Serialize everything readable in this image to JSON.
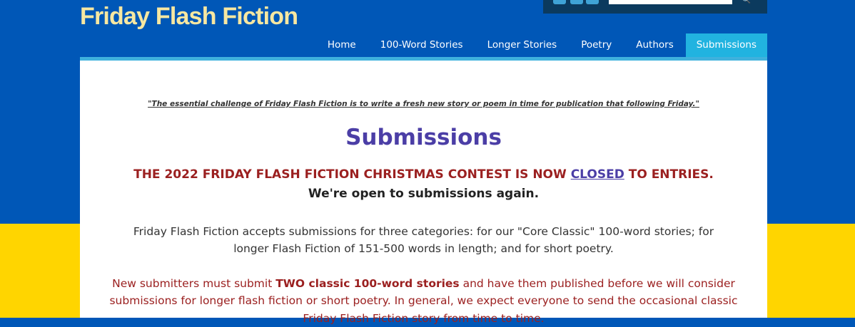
{
  "site": {
    "title": "Friday Flash Fiction"
  },
  "topbar": {
    "search_placeholder": "",
    "search_icon": "search-icon"
  },
  "nav": {
    "items": [
      {
        "label": "Home"
      },
      {
        "label": "100-Word Stories"
      },
      {
        "label": "Longer Stories"
      },
      {
        "label": "Poetry"
      },
      {
        "label": "Authors"
      },
      {
        "label": "Submissions",
        "active": true
      }
    ]
  },
  "main": {
    "quote": "\"The essential challenge of Friday Flash Fiction is to write a fresh new story or poem in time for publication that following Friday.\"",
    "heading": "Submissions",
    "announcement": {
      "part1": "THE 2022 FRIDAY FLASH FICTION CHRISTMAS CONTEST IS NOW ",
      "link": "CLOSED",
      "part2": " TO ENTRIES.",
      "part3": " We're open to submissions again."
    },
    "intro": "Friday Flash Fiction accepts submissions for three categories: for our \"Core Classic\" 100-word stories; for longer Flash Fiction of 151-500 words in length; and for short poetry.",
    "rules": {
      "part1": "New submitters must submit ",
      "bold": "TWO classic 100-word stories",
      "part2": " and have them published before we will consider submissions for longer flash fiction or short poetry. In general, we expect everyone to send the occasional classic Friday Flash Fiction story from time to time."
    }
  },
  "colors": {
    "flag_blue": "#0057b7",
    "flag_yellow": "#ffd500",
    "title": "#f7e7a1",
    "nav_active": "#21b3e0",
    "heading": "#4b3ea6",
    "alert_red": "#9b2020"
  }
}
